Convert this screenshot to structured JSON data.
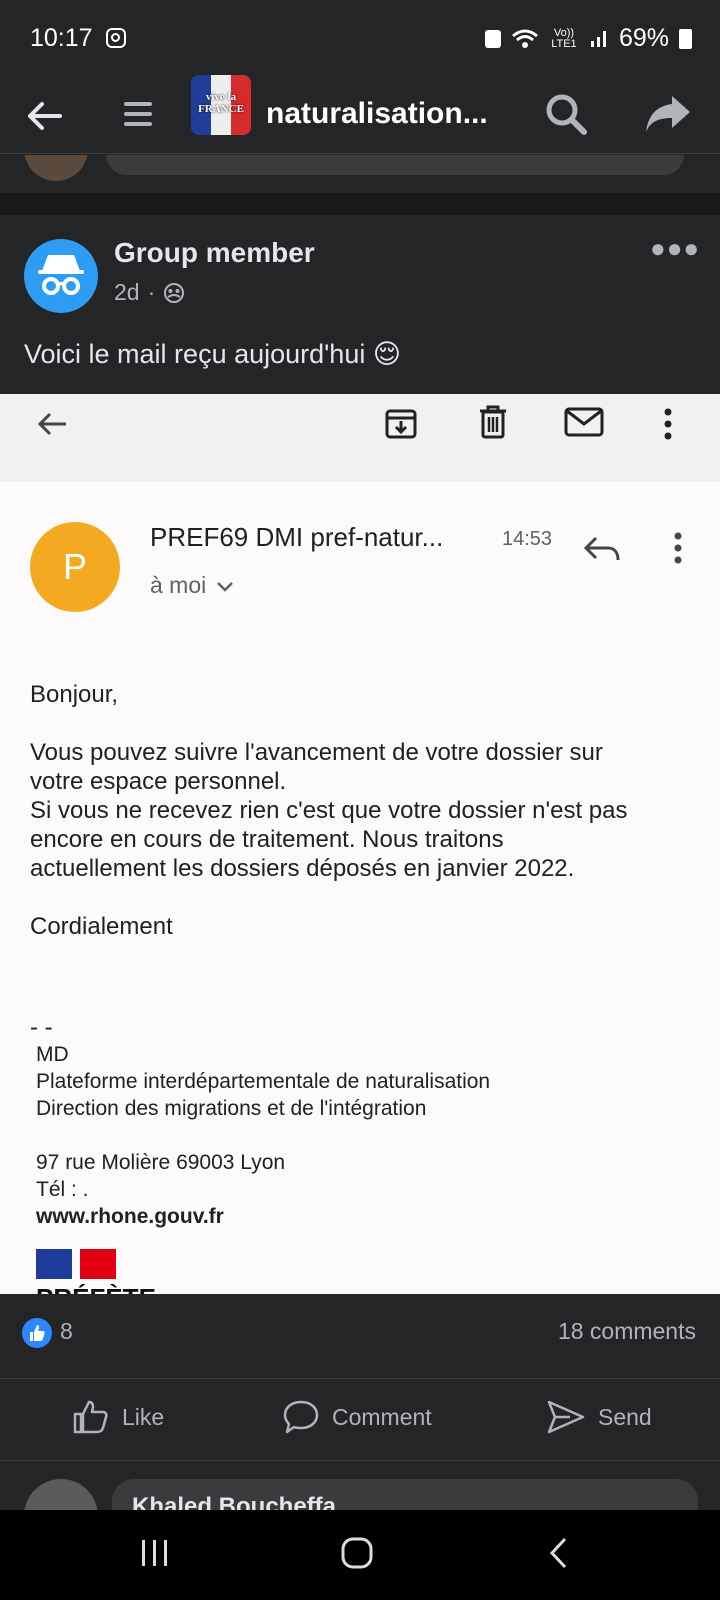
{
  "status_bar": {
    "time": "10:17",
    "network": "Vo)) LTE1",
    "battery": "69%"
  },
  "top_bar": {
    "group_title": "naturalisation...",
    "logo_text": "vive la FRANCE"
  },
  "post": {
    "author": "Group member",
    "age": "2d",
    "text": "Voici le mail reçu aujourd'hui 😌"
  },
  "email": {
    "sender_initial": "P",
    "sender": "PREF69 DMI pref-natur...",
    "time": "14:53",
    "to": "à moi",
    "body": [
      "Bonjour,",
      "Vous pouvez suivre l'avancement de votre dossier sur\nvotre espace personnel.\nSi vous ne recevez rien c'est que votre dossier n'est pas\nencore en cours de traitement. Nous traitons\nactuellement les dossiers déposés en janvier 2022.",
      "Cordialement"
    ],
    "signature": {
      "dash": "- -",
      "lines": [
        "MD",
        "Plateforme interdépartementale de naturalisation",
        "Direction des migrations et de l'intégration"
      ],
      "address": "97 rue Molière 69003 Lyon",
      "phone": "Tél : .",
      "website": "www.rhone.gouv.fr",
      "logo_text": "PRÉFÈTE"
    }
  },
  "reactions": {
    "likes": "8",
    "comments": "18 comments"
  },
  "actions": {
    "like": "Like",
    "comment": "Comment",
    "send": "Send"
  },
  "comment_preview": {
    "author": "Khaled Boucheffa"
  },
  "colors": {
    "background": "#242527",
    "facebook_blue": "#2d88ff",
    "sender_avatar": "#f4a923",
    "anon_avatar": "#2d9cf5"
  }
}
